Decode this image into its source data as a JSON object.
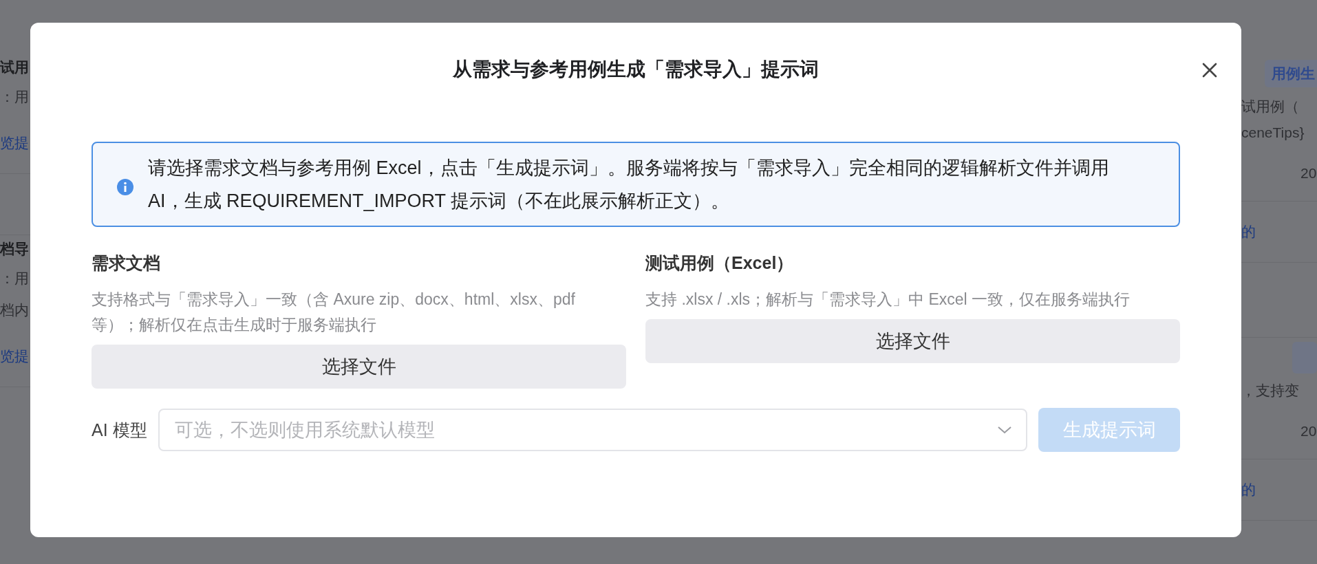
{
  "background": {
    "left": [
      {
        "kind": "title",
        "text": "试用"
      },
      {
        "kind": "desc",
        "text": "：用"
      },
      {
        "kind": "link",
        "text": "览提"
      },
      {
        "kind": "gap"
      },
      {
        "kind": "title",
        "text": "档导"
      },
      {
        "kind": "desc",
        "text": "：用"
      },
      {
        "kind": "desc",
        "text": "档内"
      },
      {
        "kind": "link",
        "text": "览提"
      }
    ],
    "right": [
      {
        "kind": "tags",
        "tags": [
          "用例生"
        ]
      },
      {
        "kind": "desc",
        "text": "试用例（"
      },
      {
        "kind": "desc",
        "text": "ceneTips}"
      },
      {
        "kind": "date",
        "text": "20"
      },
      {
        "kind": "link",
        "text": "的"
      },
      {
        "kind": "gap"
      },
      {
        "kind": "tag-stub"
      },
      {
        "kind": "desc",
        "text": "，支持变"
      },
      {
        "kind": "date",
        "text": "20"
      },
      {
        "kind": "link",
        "text": "的"
      }
    ]
  },
  "dialog": {
    "title": "从需求与参考用例生成「需求导入」提示词",
    "alert": "请选择需求文档与参考用例 Excel，点击「生成提示词」。服务端将按与「需求导入」完全相同的逻辑解析文件并调用 AI，生成 REQUIREMENT_IMPORT 提示词（不在此展示解析正文）。",
    "uploads": [
      {
        "label": "需求文档",
        "hint": "支持格式与「需求导入」一致（含 Axure zip、docx、html、xlsx、pdf 等）；解析仅在点击生成时于服务端执行",
        "button": "选择文件"
      },
      {
        "label": "测试用例（Excel）",
        "hint": "支持 .xlsx / .xls；解析与「需求导入」中 Excel 一致，仅在服务端执行",
        "button": "选择文件"
      }
    ],
    "model": {
      "label": "AI 模型",
      "placeholder": "可选，不选则使用系统默认模型"
    },
    "generate": {
      "label": "生成提示词",
      "disabled": true
    }
  }
}
